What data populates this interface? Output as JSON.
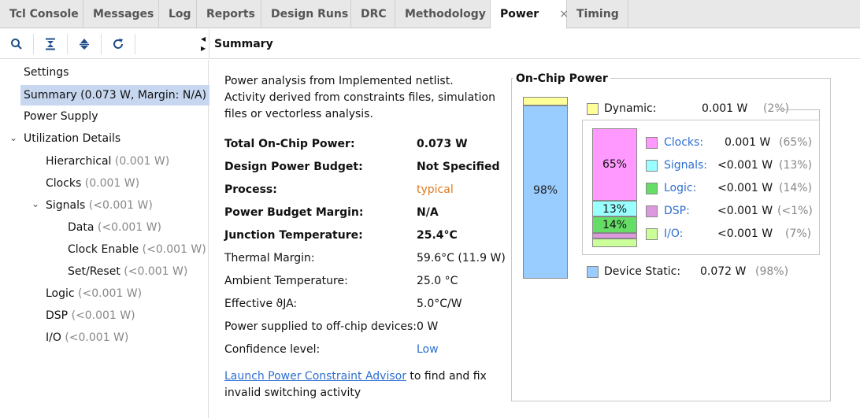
{
  "tabs": [
    {
      "label": "Tcl Console"
    },
    {
      "label": "Messages"
    },
    {
      "label": "Log"
    },
    {
      "label": "Reports"
    },
    {
      "label": "Design Runs"
    },
    {
      "label": "DRC"
    },
    {
      "label": "Methodology"
    },
    {
      "label": "Power",
      "active": true,
      "close": "×"
    },
    {
      "label": "Timing"
    }
  ],
  "toolbar": {
    "icons": [
      "search-icon",
      "collapse-all-icon",
      "expand-all-icon",
      "refresh-icon"
    ]
  },
  "header": {
    "title": "Summary"
  },
  "tree": {
    "settings": "Settings",
    "summary": "Summary (0.073 W, Margin: N/A)",
    "power_supply": "Power Supply",
    "utilization": "Utilization Details",
    "hierarchical": {
      "label": "Hierarchical",
      "value": "(0.001 W)"
    },
    "clocks": {
      "label": "Clocks",
      "value": "(0.001 W)"
    },
    "signals": {
      "label": "Signals",
      "value": "(<0.001 W)"
    },
    "data": {
      "label": "Data",
      "value": "(<0.001 W)"
    },
    "clock_enable": {
      "label": "Clock Enable",
      "value": "(<0.001 W)"
    },
    "set_reset": {
      "label": "Set/Reset",
      "value": "(<0.001 W)"
    },
    "logic": {
      "label": "Logic",
      "value": "(<0.001 W)"
    },
    "dsp": {
      "label": "DSP",
      "value": "(<0.001 W)"
    },
    "io": {
      "label": "I/O",
      "value": "(<0.001 W)"
    }
  },
  "details": {
    "intro": "Power analysis from Implemented netlist. Activity derived from constraints files, simulation files or vectorless analysis.",
    "rows": [
      {
        "label": "Total On-Chip Power:",
        "value": "0.073 W"
      },
      {
        "label": "Design Power Budget:",
        "value": "Not Specified"
      },
      {
        "label": "Process:",
        "value": "typical"
      },
      {
        "label": "Power Budget Margin:",
        "value": "N/A"
      },
      {
        "label": "Junction Temperature:",
        "value": "25.4°C"
      },
      {
        "label": "Thermal Margin:",
        "value": "59.6°C (11.9 W)"
      },
      {
        "label": "Ambient Temperature:",
        "value": "25.0 °C"
      },
      {
        "label": "Effective ϑJA:",
        "value": "5.0°C/W"
      },
      {
        "label": "Power supplied to off-chip devices:",
        "value": "0 W"
      },
      {
        "label": "Confidence level:",
        "value": "Low"
      }
    ],
    "advisor_link": "Launch Power Constraint Advisor",
    "advisor_text": " to find and fix invalid switching activity"
  },
  "onchip": {
    "title": "On-Chip Power",
    "device_pct_label": "98%",
    "dynamic": {
      "label": "Dynamic:",
      "value": "0.001 W",
      "pct": "(2%)",
      "fraction": 0.02
    },
    "device_static": {
      "label": "Device Static:",
      "value": "0.072 W",
      "pct": "(98%)",
      "fraction": 0.98
    },
    "breakdown": [
      {
        "label": "Clocks:",
        "value": "0.001 W",
        "pct": "(65%)",
        "bar_label": "65%",
        "fraction": 0.65
      },
      {
        "label": "Signals:",
        "value": "<0.001 W",
        "pct": "(13%)",
        "bar_label": "13%",
        "fraction": 0.13
      },
      {
        "label": "Logic:",
        "value": "<0.001 W",
        "pct": "(14%)",
        "bar_label": "14%",
        "fraction": 0.14
      },
      {
        "label": "DSP:",
        "value": "<0.001 W",
        "pct": "(<1%)",
        "bar_label": "",
        "fraction": 0.01
      },
      {
        "label": "I/O:",
        "value": "<0.001 W",
        "pct": "(7%)",
        "bar_label": "7%",
        "fraction": 0.07
      }
    ],
    "colors": {
      "dynamic": "#ffff99",
      "static": "#99ccff",
      "clocks": "#ff99ff",
      "signals": "#99ffff",
      "logic": "#66dd66",
      "dsp": "#dd99dd",
      "io": "#ccff99"
    }
  }
}
